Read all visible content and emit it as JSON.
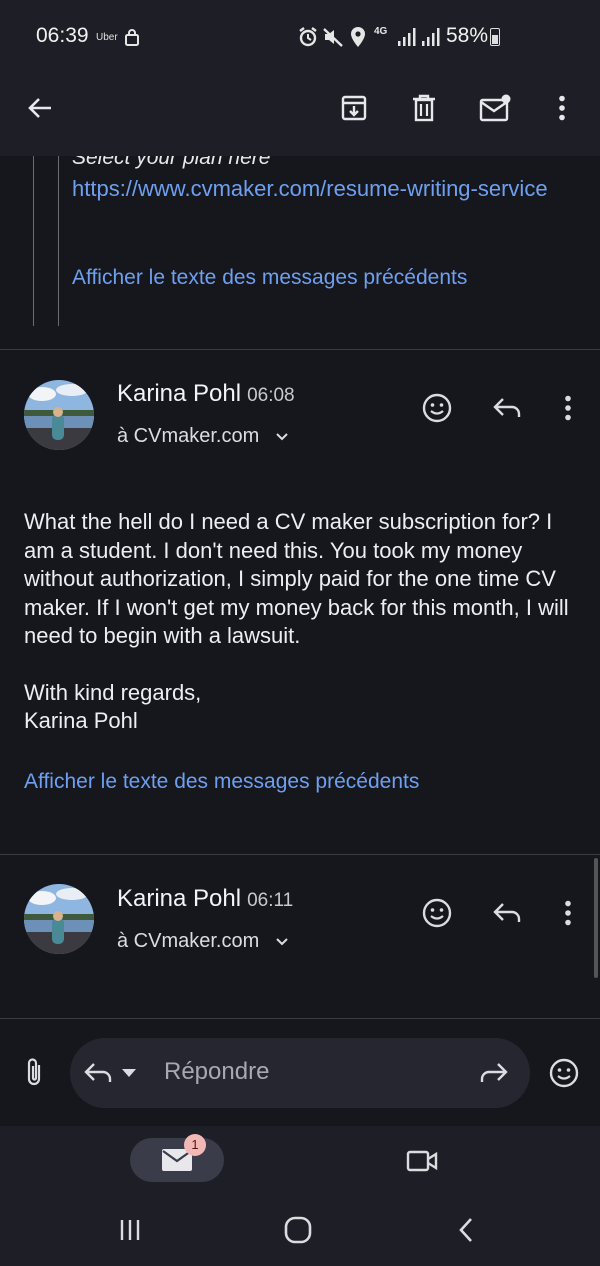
{
  "status_bar": {
    "time": "06:39",
    "carrier": "Uber",
    "network": "4G",
    "battery": "58%"
  },
  "app_bar": {
    "icons": [
      "back-arrow-icon",
      "archive-icon",
      "delete-icon",
      "mark-unread-icon",
      "more-vert-icon"
    ]
  },
  "quoted": {
    "plan_line": "Select your plan here",
    "link": "https://www.cvmaker.com/resume-writing-service",
    "show_previous": "Afficher le texte des messages précédents"
  },
  "messages": [
    {
      "sender": "Karina Pohl",
      "time": "06:08",
      "to": "à CVmaker.com",
      "body": [
        "What the hell do I need a CV maker subscription for? I am a student. I don't need this. You took my money without authorization, I simply paid for the one time CV maker. If I won't get my money back for this month, I will need to begin with a lawsuit.",
        "With kind regards,",
        "Karina Pohl"
      ],
      "show_previous": "Afficher le texte des messages précédents"
    },
    {
      "sender": "Karina Pohl",
      "time": "06:11",
      "to": "à CVmaker.com"
    }
  ],
  "compose": {
    "placeholder": "Répondre"
  },
  "bottom_nav": {
    "mail_badge": "1"
  },
  "colors": {
    "background": "#16161d",
    "link": "#6ea0ef",
    "bar": "#1e1f26"
  }
}
